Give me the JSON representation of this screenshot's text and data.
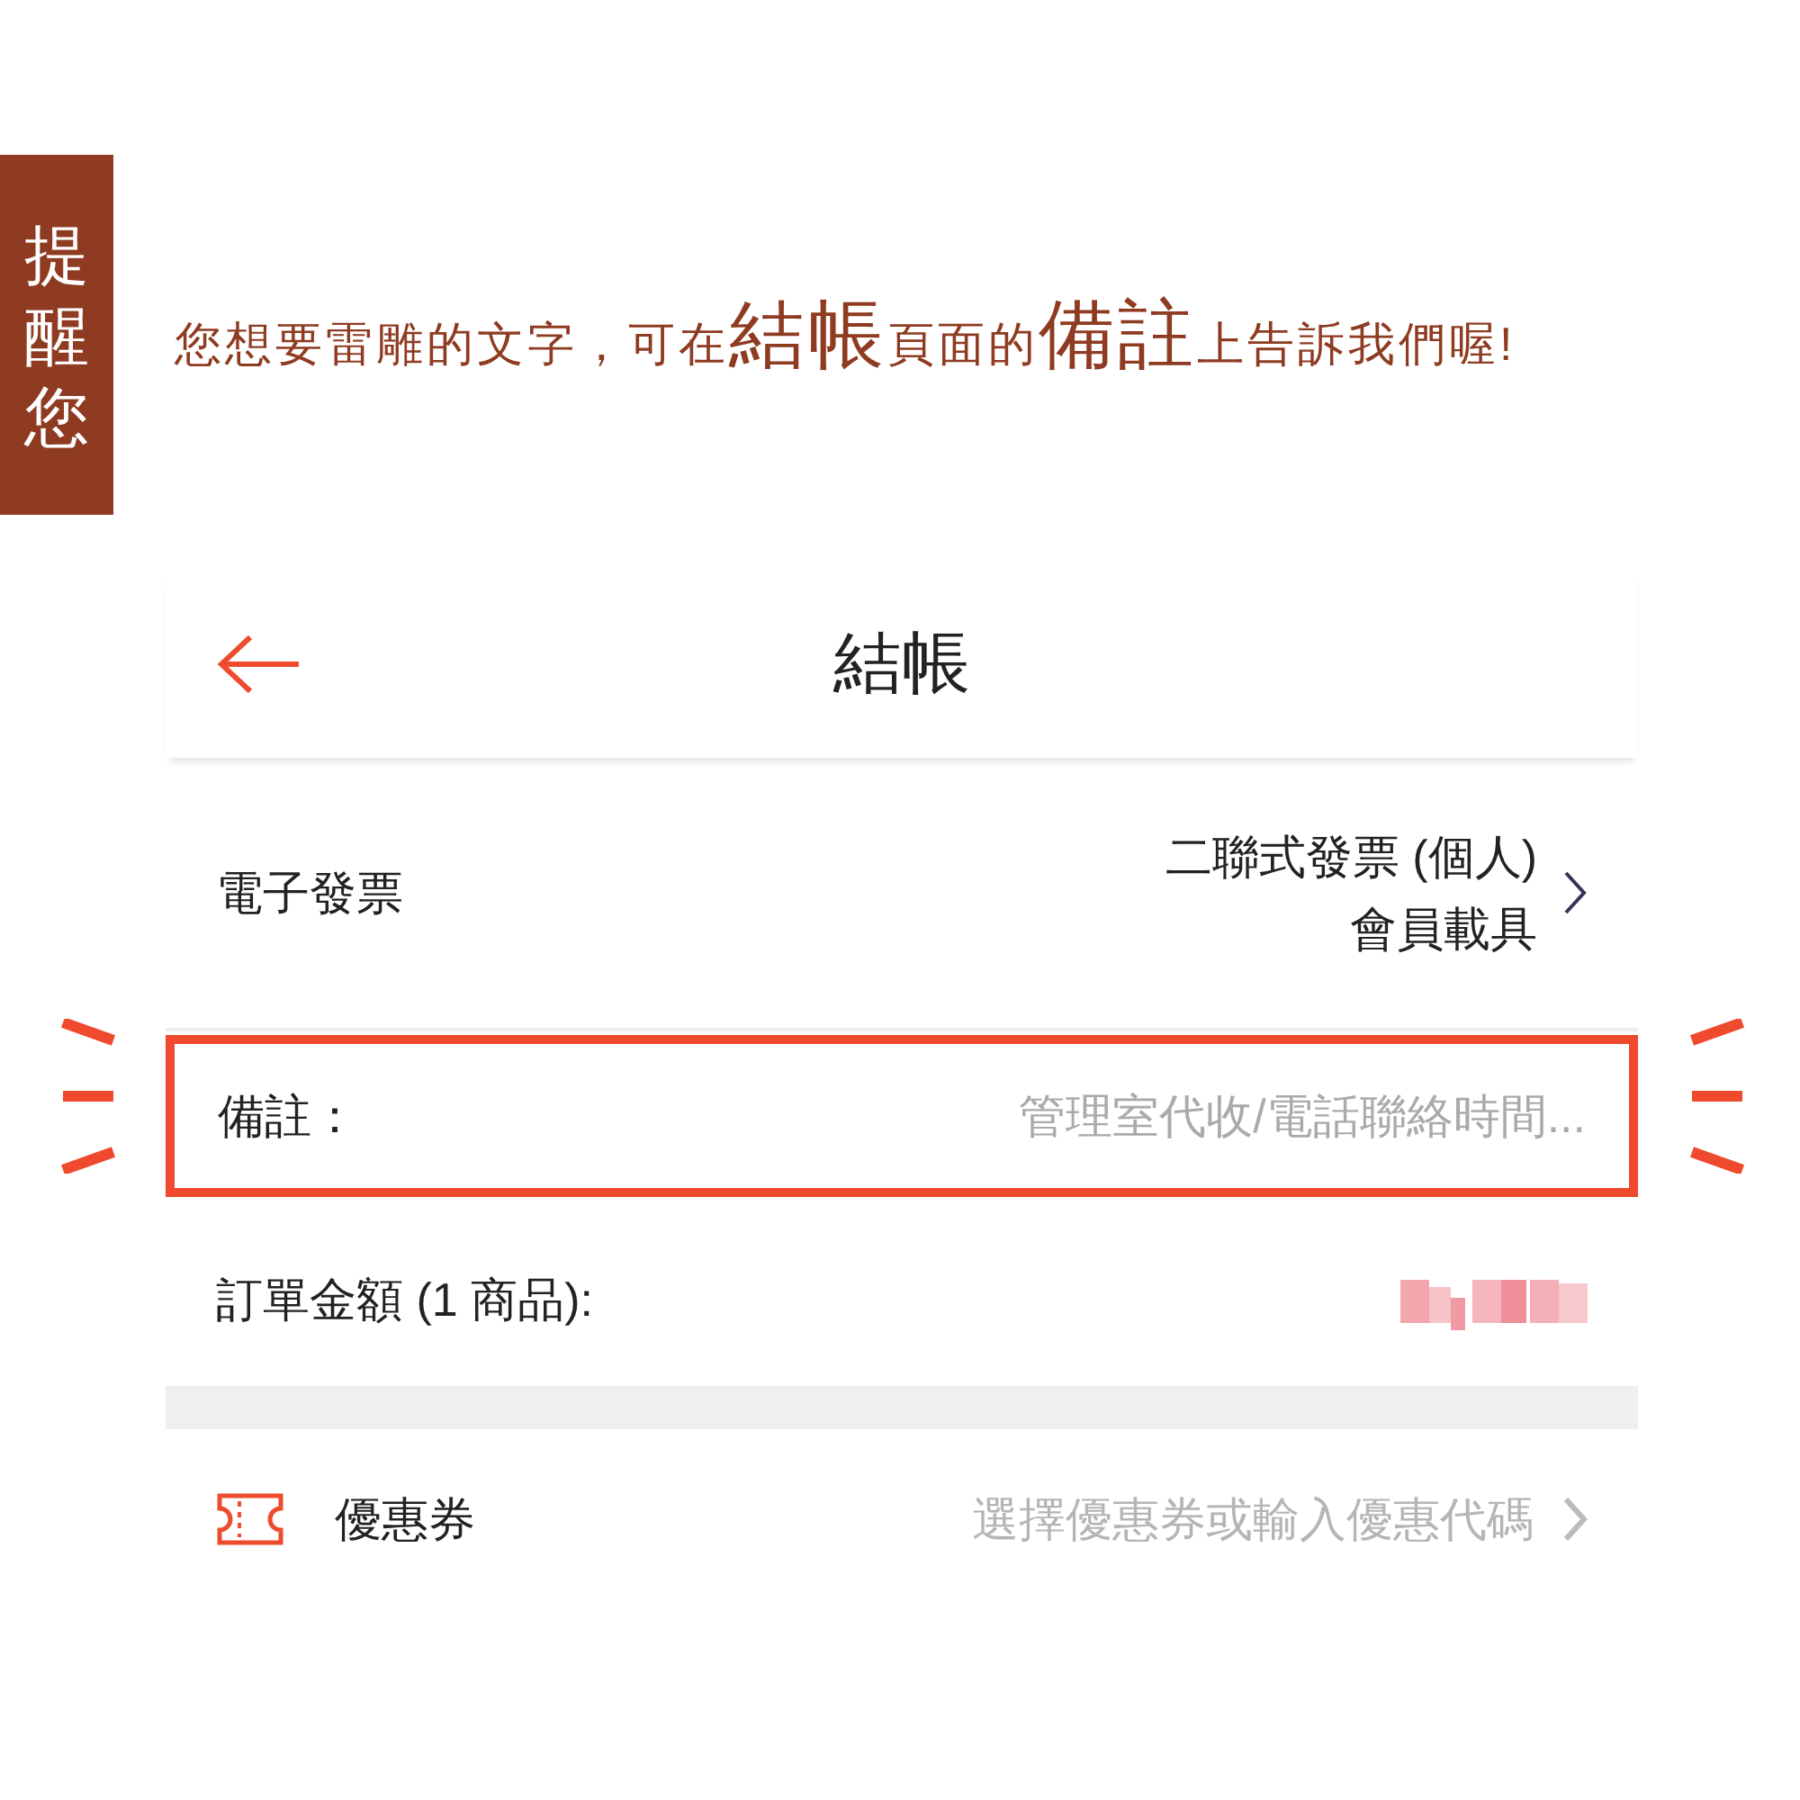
{
  "side_tab": {
    "label": "提醒您"
  },
  "notice": {
    "segments": [
      {
        "text": "您想要雷雕的文字，可在",
        "large": false
      },
      {
        "text": "結帳",
        "large": true
      },
      {
        "text": "頁面的",
        "large": false
      },
      {
        "text": "備註",
        "large": true
      },
      {
        "text": "上告訴我們喔!",
        "large": false
      }
    ]
  },
  "checkout": {
    "title": "結帳",
    "invoice": {
      "label": "電子發票",
      "value_lines": [
        "二聯式發票 (個人)",
        "會員載具"
      ]
    },
    "remark": {
      "label": "備註：",
      "placeholder": "管理室代收/電話聯絡時間...",
      "highlighted": true
    },
    "order_total": {
      "label": "訂單金額 (1 商品):"
    },
    "coupon": {
      "label": "優惠券",
      "hint": "選擇優惠券或輸入優惠代碼"
    }
  }
}
